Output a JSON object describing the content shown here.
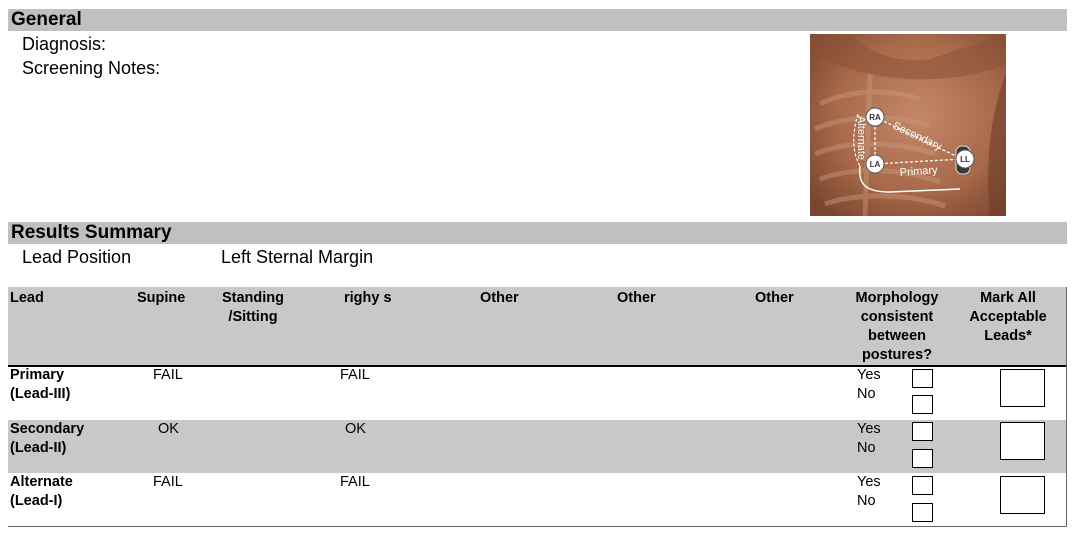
{
  "general": {
    "title": "General",
    "diagnosis_label": "Diagnosis:",
    "screening_notes_label": "Screening Notes:"
  },
  "illustration": {
    "electrodes": [
      "RA",
      "LA",
      "LL"
    ],
    "vectors": [
      "Secondary",
      "Alternate",
      "Primary"
    ]
  },
  "results": {
    "title": "Results Summary",
    "lead_position_label": "Lead Position",
    "lead_position_value": "Left Sternal Margin"
  },
  "table": {
    "headers": {
      "lead": "Lead",
      "supine": "Supine",
      "standing_1": "Standing",
      "standing_2": "/Sitting",
      "custom": "righy s",
      "other1": "Other",
      "other2": "Other",
      "other3": "Other",
      "morph_1": "Morphology",
      "morph_2": "consistent",
      "morph_3": "between",
      "morph_4": "postures?",
      "mark_1": "Mark All",
      "mark_2": "Acceptable",
      "mark_3": "Leads*"
    },
    "rows": [
      {
        "lead_1": "Primary",
        "lead_2": "(Lead-III)",
        "supine": "FAIL",
        "custom": "FAIL",
        "yes": "Yes",
        "no": "No"
      },
      {
        "lead_1": "Secondary",
        "lead_2": "(Lead-II)",
        "supine": "OK",
        "custom": "OK",
        "yes": "Yes",
        "no": "No"
      },
      {
        "lead_1": "Alternate",
        "lead_2": "(Lead-I)",
        "supine": "FAIL",
        "custom": "FAIL",
        "yes": "Yes",
        "no": "No"
      }
    ]
  },
  "colors": {
    "section_bar": "#c0c0c0",
    "skin": "#a86a4a",
    "vector_line": "#ffffff"
  }
}
